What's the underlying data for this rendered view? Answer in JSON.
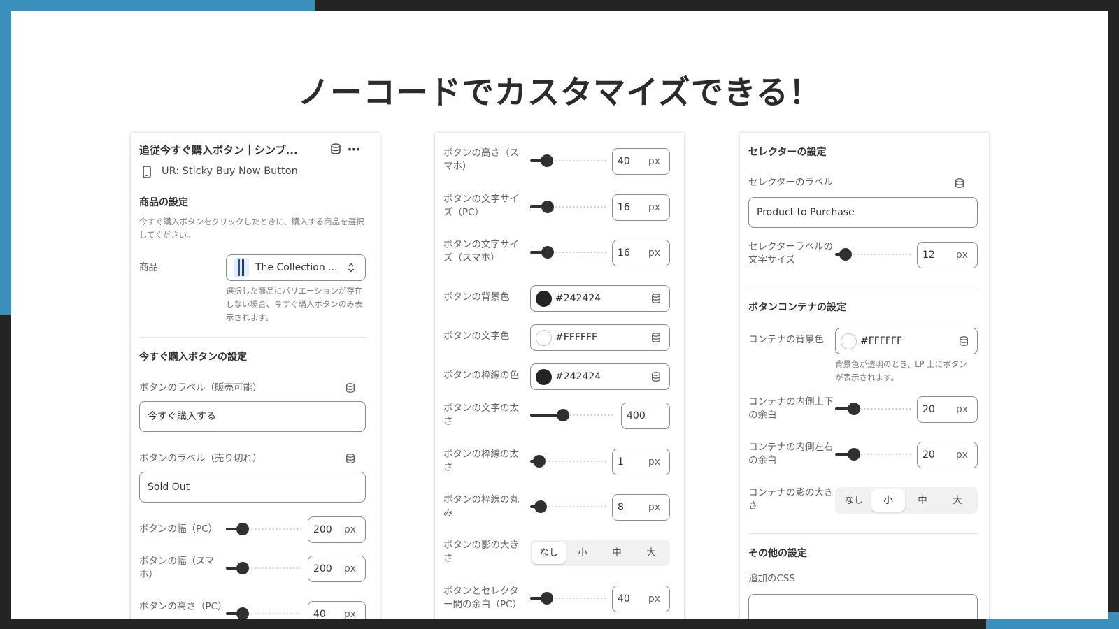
{
  "headline": "ノーコードでカスタマイズできる！",
  "colors": {
    "accent": "#3a8fbc",
    "frame": "#242424",
    "control_dark": "#303030"
  },
  "panel_left": {
    "title": "追従今すぐ購入ボタン｜シンプ...",
    "app_label": "UR: Sticky Buy Now Button",
    "section_product": "商品の設定",
    "product_help": "今すぐ購入ボタンをクリックしたときに、購入する商品を選択してください。",
    "product_label": "商品",
    "product_value": "The Collection ...",
    "product_note": "選択した商品にバリエーションが存在しない場合、今すぐ購入ボタンのみ表示されます。",
    "section_button": "今すぐ購入ボタンの設定",
    "label_available": "ボタンのラベル（販売可能）",
    "value_available": "今すぐ購入する",
    "label_soldout": "ボタンのラベル（売り切れ）",
    "value_soldout": "Sold Out",
    "width_pc_label": "ボタンの幅（PC）",
    "width_pc_value": "200",
    "width_pc_unit": "px",
    "width_sp_label": "ボタンの幅（スマホ）",
    "width_sp_value": "200",
    "width_sp_unit": "px",
    "height_pc_label": "ボタンの高さ（PC）",
    "height_pc_value": "40",
    "height_pc_unit": "px"
  },
  "panel_middle": {
    "height_sp_label": "ボタンの高さ（スマホ）",
    "height_sp_value": "40",
    "font_pc_label": "ボタンの文字サイズ（PC）",
    "font_pc_value": "16",
    "font_sp_label": "ボタンの文字サイズ（スマホ）",
    "font_sp_value": "16",
    "unit": "px",
    "bg_label": "ボタンの背景色",
    "bg_value": "#242424",
    "text_color_label": "ボタンの文字色",
    "text_color_value": "#FFFFFF",
    "border_color_label": "ボタンの枠線の色",
    "border_color_value": "#242424",
    "weight_label": "ボタンの文字の太さ",
    "weight_value": "400",
    "border_width_label": "ボタンの枠線の太さ",
    "border_width_value": "1",
    "radius_label": "ボタンの枠線の丸み",
    "radius_value": "8",
    "shadow_label": "ボタンの影の大きさ",
    "shadow_options": [
      "なし",
      "小",
      "中",
      "大"
    ],
    "shadow_selected": "なし",
    "gap_label": "ボタンとセレクター間の余白（PC）",
    "gap_value": "40"
  },
  "panel_right": {
    "section_selector": "セレクターの設定",
    "selector_label_label": "セレクターのラベル",
    "selector_label_value": "Product to Purchase",
    "selector_font_label": "セレクターラベルの文字サイズ",
    "selector_font_value": "12",
    "unit": "px",
    "section_container": "ボタンコンテナの設定",
    "container_bg_label": "コンテナの背景色",
    "container_bg_value": "#FFFFFF",
    "container_bg_help": "背景色が透明のとき、LP 上にボタンが表示されます。",
    "pad_v_label": "コンテナの内側上下の余白",
    "pad_v_value": "20",
    "pad_h_label": "コンテナの内側左右の余白",
    "pad_h_value": "20",
    "shadow_label": "コンテナの影の大きさ",
    "shadow_options": [
      "なし",
      "小",
      "中",
      "大"
    ],
    "shadow_selected": "小",
    "section_other": "その他の設定",
    "css_label": "追加のCSS"
  },
  "slider_levels": {
    "width_pc": 0.22,
    "width_sp": 0.22,
    "height_pc": 0.22,
    "height_sp": 0.22,
    "font_pc": 0.23,
    "font_sp": 0.23,
    "weight": 0.39,
    "border_width": 0.12,
    "radius": 0.14,
    "gap": 0.22,
    "selector_font": 0.14,
    "pad_v": 0.25,
    "pad_h": 0.25
  }
}
